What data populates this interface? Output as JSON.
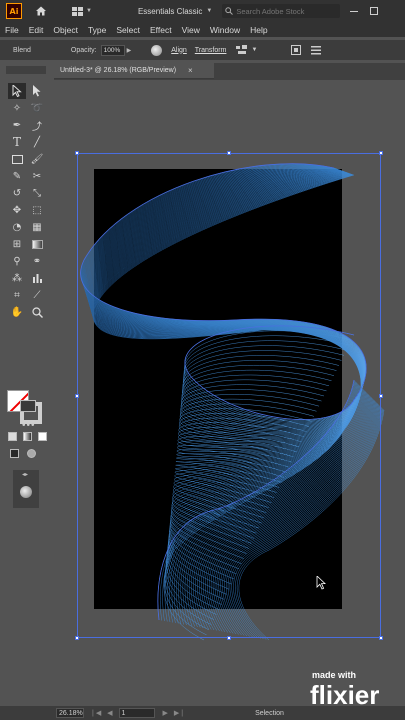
{
  "titlebar": {
    "app_logo_text": "Ai",
    "workspace": "Essentials Classic",
    "search_placeholder": "Search Adobe Stock"
  },
  "menu": [
    "File",
    "Edit",
    "Object",
    "Type",
    "Select",
    "Effect",
    "View",
    "Window",
    "Help"
  ],
  "controlbar": {
    "selection_label": "Blend",
    "opacity_label": "Opacity:",
    "opacity_value": "100%",
    "align_label": "Align",
    "transform_label": "Transform"
  },
  "document": {
    "tab_title": "Untitled-3* @ 26.18% (RGB/Preview)",
    "close_glyph": "×"
  },
  "statusbar": {
    "zoom": "26.18%",
    "nav": "|◀ ◀",
    "artboard_number": "1",
    "nav_next": "▶ ▶|",
    "current_tool": "Selection"
  },
  "watermark": {
    "small": "made with",
    "big": "flixier"
  },
  "colors": {
    "ribbon_light": "#63b4ff",
    "ribbon_dark": "#1a4f8a",
    "selection_bbox": "#4a6ee0",
    "artboard": "#000000"
  }
}
